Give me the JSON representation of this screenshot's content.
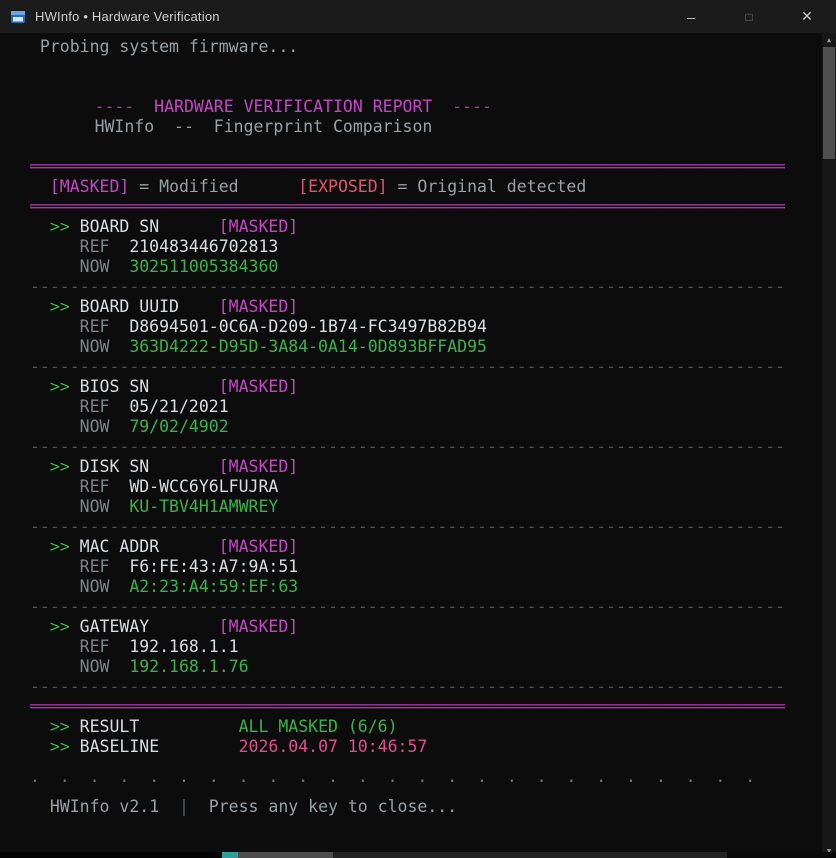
{
  "window": {
    "title": "HWInfo • Hardware Verification",
    "minimize": "–",
    "maximize": "□",
    "close": "✕"
  },
  "icons": {
    "scroll_up": "▲",
    "scroll_down": "▼"
  },
  "colors": {
    "green": "#3bb24a",
    "magenta": "#c844c8",
    "magenta_dim": "#a835a8",
    "exposed": "#e0566f",
    "baseline": "#de4f92"
  },
  "terminal": {
    "probing": "Probing system firmware...",
    "report": {
      "left_dashes": "----",
      "title": "HARDWARE VERIFICATION REPORT",
      "right_dashes": "----",
      "subtitle_app": "HWInfo",
      "subtitle_sep": "--",
      "subtitle_text": "Fingerprint Comparison"
    },
    "legend": {
      "masked_tag": "[MASKED]",
      "masked_meaning": "= Modified",
      "exposed_tag": "[EXPOSED]",
      "exposed_meaning": "= Original detected"
    },
    "arrow": ">>",
    "ref_label": "REF",
    "now_label": "NOW",
    "sections": [
      {
        "name": "BOARD SN",
        "tag": "[MASKED]",
        "ref": "210483446702813",
        "now": "302511005384360"
      },
      {
        "name": "BOARD UUID",
        "tag": "[MASKED]",
        "ref": "D8694501-0C6A-D209-1B74-FC3497B82B94",
        "now": "363D4222-D95D-3A84-0A14-0D893BFFAD95"
      },
      {
        "name": "BIOS SN",
        "tag": "[MASKED]",
        "ref": "05/21/2021",
        "now": "79/02/4902"
      },
      {
        "name": "DISK SN",
        "tag": "[MASKED]",
        "ref": "WD-WCC6Y6LFUJRA",
        "now": "KU-TBV4H1AMWREY"
      },
      {
        "name": "MAC ADDR",
        "tag": "[MASKED]",
        "ref": "F6:FE:43:A7:9A:51",
        "now": "A2:23:A4:59:EF:63"
      },
      {
        "name": "GATEWAY",
        "tag": "[MASKED]",
        "ref": "192.168.1.1",
        "now": "192.168.1.76"
      }
    ],
    "result_label": "RESULT",
    "result_value": "ALL MASKED (6/6)",
    "baseline_label": "BASELINE",
    "baseline_value": "2026.04.07 10:46:57",
    "footer_version": "HWInfo v2.1",
    "footer_sep": "|",
    "footer_msg": "Press any key to close...",
    "sep_double": "════════════════════════════════════════════════════════════════════════════",
    "sep_dash": "----------------------------------------------------------------------------",
    "dots": ".  .  .  .  .  .  .  .  .  .  .  .  .  .  .  .  .  .  .  .  .  .  .  .  ."
  }
}
